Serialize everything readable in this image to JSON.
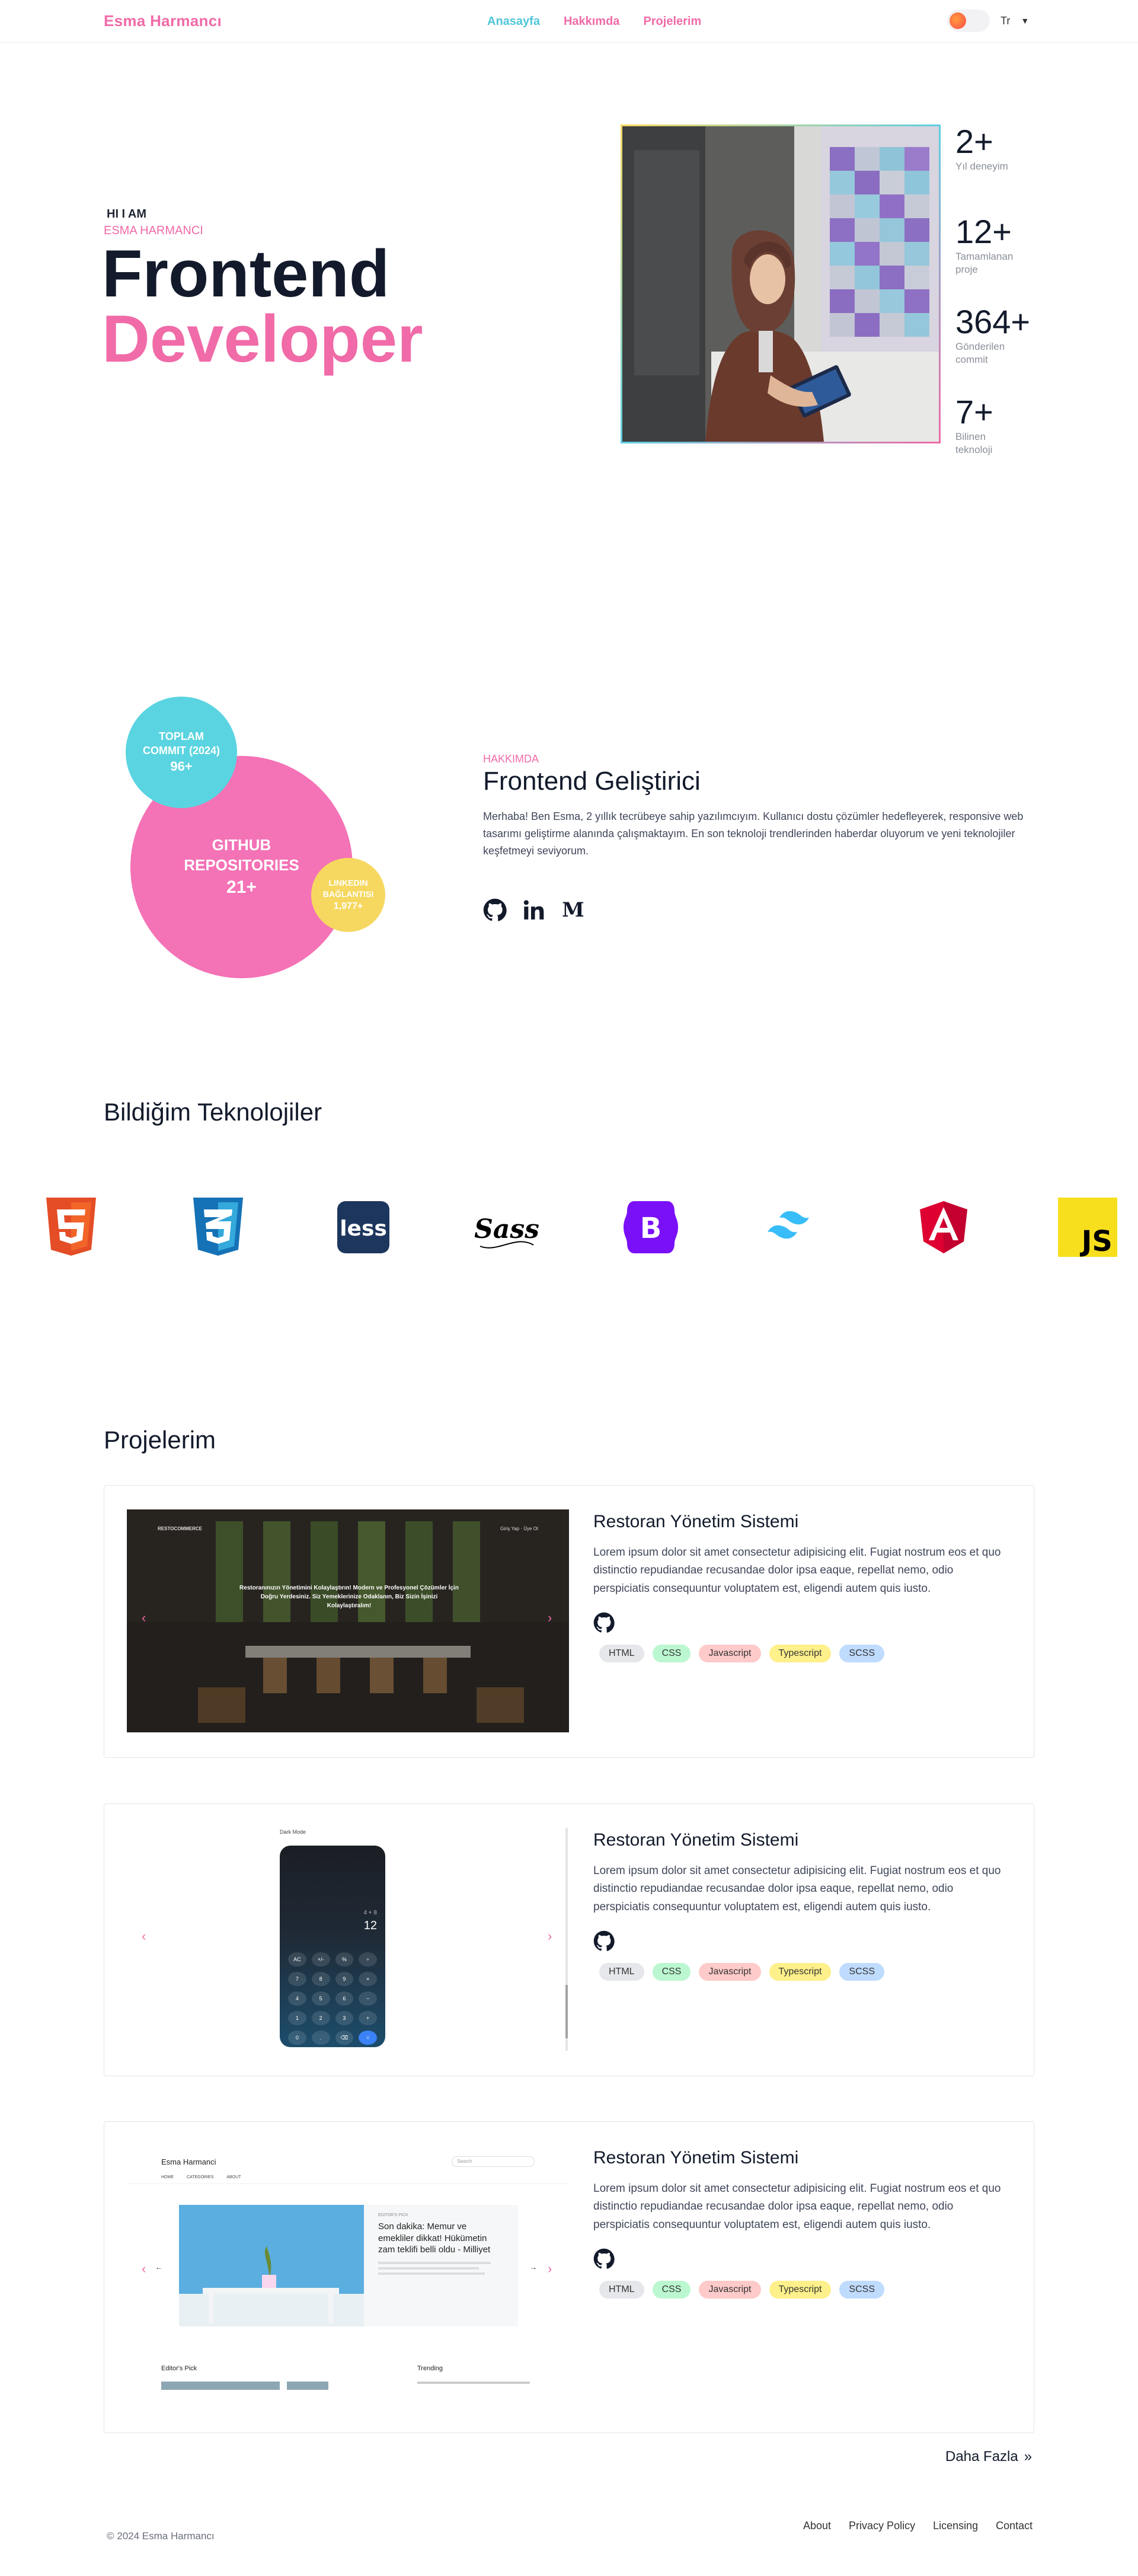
{
  "nav": {
    "brand": "Esma Harmancı",
    "links": [
      {
        "label": "Anasayfa",
        "color": "#4fc6d8"
      },
      {
        "label": "Hakkımda",
        "color": "#f06ba8"
      },
      {
        "label": "Projelerim",
        "color": "#f06ba8"
      }
    ],
    "language": "Tr"
  },
  "hero": {
    "eyebrow": "HI I AM",
    "name": "ESMA HARMANCI",
    "title_line1": "Frontend",
    "title_line2": "Developer",
    "stats": [
      {
        "value": "2+",
        "label": "Yıl deneyim"
      },
      {
        "value": "12+",
        "label": "Tamamlanan proje"
      },
      {
        "value": "364+",
        "label": "Gönderilen commit"
      },
      {
        "value": "7+",
        "label": "Bilinen teknoloji"
      }
    ]
  },
  "about": {
    "bubbles": {
      "github_label": "GITHUB REPOSITORIES",
      "github_value": "21+",
      "commit_label": "TOPLAM COMMIT (2024)",
      "commit_value": "96+",
      "linkedin_label": "LINKEDIN BAĞLANTISI",
      "linkedin_value": "1,977+"
    },
    "tag": "HAKKIMDA",
    "title": "Frontend Geliştirici",
    "text": "Merhaba! Ben Esma, 2 yıllık tecrübeye sahip yazılımcıyım. Kullanıcı dostu çözümler hedefleyerek, responsive web tasarımı geliştirme alanında çalışmaktayım. En son teknoloji trendlerinden haberdar oluyorum ve yeni teknolojiler keşfetmeyi seviyorum.",
    "socials": [
      "github-icon",
      "linkedin-icon",
      "medium-icon"
    ]
  },
  "tech": {
    "title": "Bildiğim Teknolojiler",
    "icons": [
      "html5-icon",
      "css3-icon",
      "less-icon",
      "sass-icon",
      "bootstrap-icon",
      "tailwind-icon",
      "angular-icon",
      "javascript-icon"
    ]
  },
  "projects": {
    "title": "Projelerim",
    "items": [
      {
        "title": "Restoran Yönetim Sistemi",
        "desc": "Lorem ipsum dolor sit amet consectetur adipisicing elit. Fugiat nostrum eos et quo distinctio repudiandae recusandae dolor ipsa eaque, repellat nemo, odio perspiciatis consequuntur voluptatem est, eligendi autem quis iusto.",
        "tags": [
          "HTML",
          "CSS",
          "Javascript",
          "Typescript",
          "SCSS"
        ],
        "preview": {
          "logo": "RESTOCOMMERCE",
          "nav": "Giriş Yap  ·  Üye Ol",
          "headline": "Restoranınızın Yönetimini Kolaylaştırın! Modern ve Profesyonel Çözümler İçin Doğru Yerdesiniz. Siz Yemeklerinize Odaklanın, Biz Sizin İşinizi Kolaylaştıralım!"
        }
      },
      {
        "title": "Restoran Yönetim Sistemi",
        "desc": "Lorem ipsum dolor sit amet consectetur adipisicing elit. Fugiat nostrum eos et quo distinctio repudiandae recusandae dolor ipsa eaque, repellat nemo, odio perspiciatis consequuntur voluptatem est, eligendi autem quis iusto.",
        "tags": [
          "HTML",
          "CSS",
          "Javascript",
          "Typescript",
          "SCSS"
        ],
        "preview": {
          "mode": "Dark Mode",
          "display_expr": "4 + 8",
          "display_result": "12",
          "keys": [
            "AC",
            "+/-",
            "%",
            "÷",
            "7",
            "8",
            "9",
            "×",
            "4",
            "5",
            "6",
            "−",
            "1",
            "2",
            "3",
            "+",
            "0",
            ".",
            "⌫",
            "="
          ]
        }
      },
      {
        "title": "Restoran Yönetim Sistemi",
        "desc": "Lorem ipsum dolor sit amet consectetur adipisicing elit. Fugiat nostrum eos et quo distinctio repudiandae recusandae dolor ipsa eaque, repellat nemo, odio perspiciatis consequuntur voluptatem est, eligendi autem quis iusto.",
        "tags": [
          "HTML",
          "CSS",
          "Javascript",
          "Typescript",
          "SCSS"
        ],
        "preview": {
          "site": "Esma Harmanci",
          "search": "Search",
          "menu": [
            "HOME",
            "CATEGORIES",
            "ABOUT"
          ],
          "pick_label": "EDITOR'S PICK",
          "headline": "Son dakika: Memur ve emekliler dikkat! Hükümetin zam teklifi belli oldu - Milliyet",
          "editors_pick": "Editor's Pick",
          "trending": "Trending"
        }
      }
    ],
    "more": "Daha Fazla"
  },
  "footer": {
    "copyright": "© 2024 Esma Harmancı",
    "links": [
      "About",
      "Privacy Policy",
      "Licensing",
      "Contact"
    ]
  },
  "colors": {
    "pink": "#f06ba8",
    "cyan": "#5ad4e0",
    "yellow": "#f6d860",
    "dark": "#121a2b"
  }
}
